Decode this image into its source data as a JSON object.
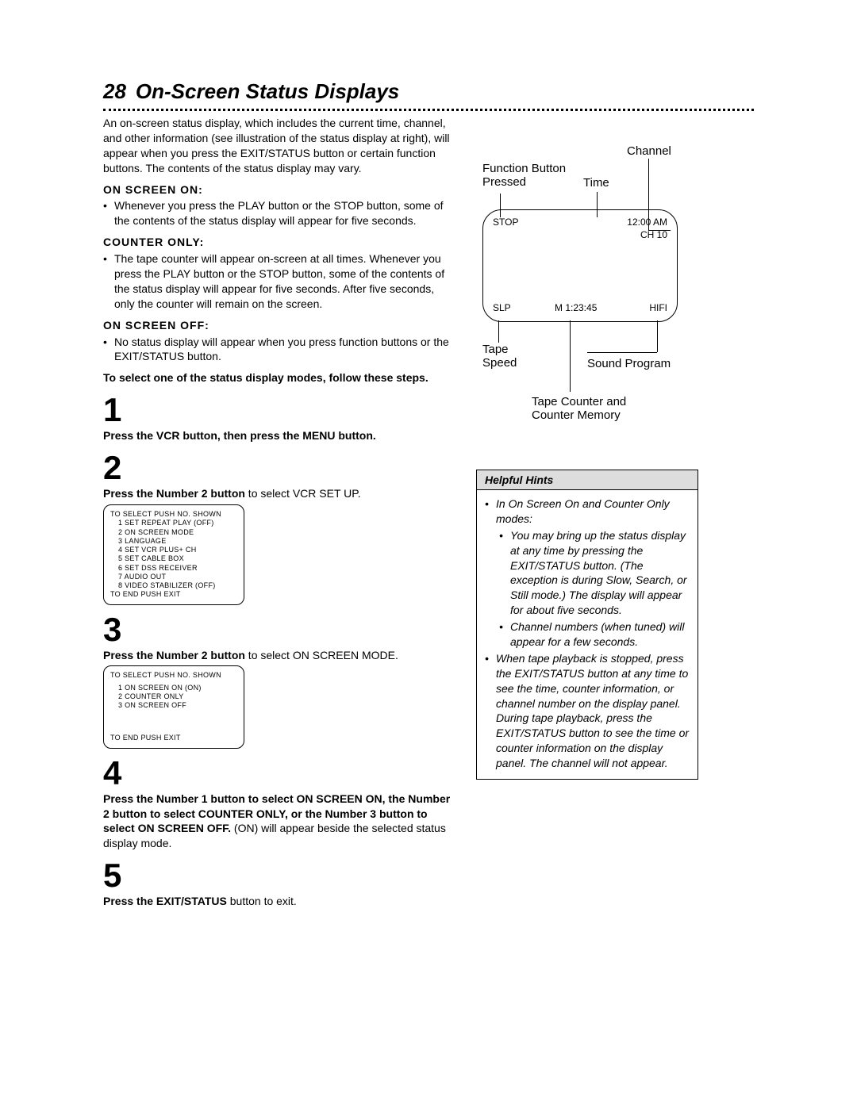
{
  "chapter_number": "28",
  "chapter_title": "On-Screen Status Displays",
  "intro": "An on-screen status display, which includes the current time, channel, and other information (see illustration of the status display at right), will appear when you press the EXIT/STATUS button or certain function buttons. The contents of the status display may vary.",
  "modes": {
    "on": {
      "head": "ON SCREEN ON:",
      "text": "Whenever you press the PLAY button or the STOP button, some of the contents of the status display will appear for five seconds."
    },
    "counter": {
      "head": "COUNTER ONLY:",
      "text": "The tape counter will appear on-screen at all times. Whenever you press the PLAY button or the STOP button, some of the contents of the status display will appear for five seconds. After five seconds, only the counter will remain on the screen."
    },
    "off": {
      "head": "ON SCREEN OFF:",
      "text": "No status display will appear when you press function buttons or the EXIT/STATUS button."
    }
  },
  "follow_head": "To select one of the status display modes, follow these steps.",
  "steps": {
    "s1": {
      "num": "1",
      "bold": "Press the VCR button, then press the MENU button."
    },
    "s2": {
      "num": "2",
      "bold": "Press the Number 2 button",
      "rest": " to select VCR SET UP."
    },
    "s3": {
      "num": "3",
      "bold": "Press the Number 2 button",
      "rest": " to select ON SCREEN MODE."
    },
    "s4": {
      "num": "4",
      "bold": "Press the Number 1 button to select ON SCREEN ON, the Number 2 button to select COUNTER ONLY, or the Number 3 button to select ON SCREEN OFF.",
      "rest": " (ON) will appear beside the selected status display mode."
    },
    "s5": {
      "num": "5",
      "bold": "Press the EXIT/STATUS",
      "rest": " button to exit."
    }
  },
  "osd_box1": {
    "title": "TO SELECT PUSH NO. SHOWN",
    "lines": [
      "1  SET REPEAT PLAY  (OFF)",
      "2  ON SCREEN MODE",
      "3  LANGUAGE",
      "4  SET VCR PLUS+ CH",
      "5  SET CABLE BOX",
      "6  SET DSS RECEIVER",
      "7  AUDIO OUT",
      "8  VIDEO STABILIZER (OFF)"
    ],
    "footer": "TO END PUSH EXIT"
  },
  "osd_box2": {
    "title": "TO SELECT PUSH NO. SHOWN",
    "lines": [
      "1  ON SCREEN ON        (ON)",
      "2  COUNTER ONLY",
      "3  ON SCREEN OFF"
    ],
    "footer": "TO END PUSH EXIT"
  },
  "illus": {
    "channel": "Channel",
    "function_pressed": "Function Button\nPressed",
    "time": "Time",
    "tape_speed": "Tape\nSpeed",
    "sound_program": "Sound Program",
    "tape_counter": "Tape Counter and\nCounter Memory",
    "tv": {
      "stop": "STOP",
      "clock": "12:00 AM",
      "ch": "CH 10",
      "slp": "SLP",
      "counter": "M  1:23:45",
      "hifi": "HIFI"
    }
  },
  "hints": {
    "title": "Helpful Hints",
    "top": "In On Screen On and Counter Only modes:",
    "sub1": "You may bring up the status display at any time by pressing the EXIT/STATUS button. (The exception is during Slow, Search, or Still mode.) The display will appear for about five seconds.",
    "sub2": "Channel numbers (when tuned) will appear for a few seconds.",
    "para2": "When tape playback is stopped, press the EXIT/STATUS button at any time to see the time, counter information, or channel number on the display panel. During tape playback, press the EXIT/STATUS button to see the time or counter information on the display panel. The channel will not appear."
  }
}
